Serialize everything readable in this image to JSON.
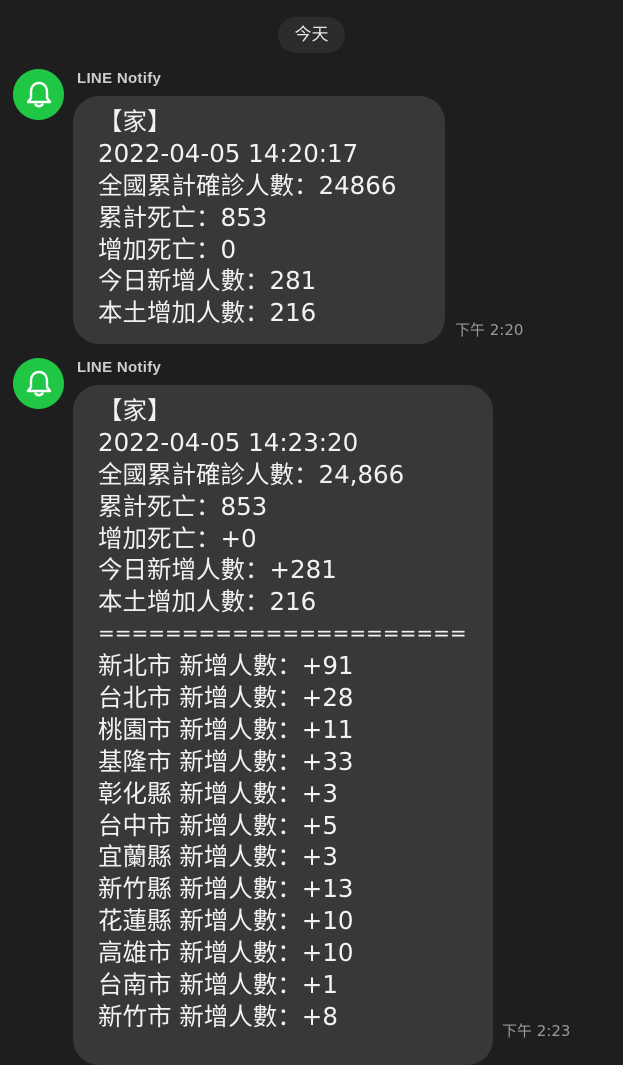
{
  "date_divider": "今天",
  "messages": [
    {
      "sender": "LINE Notify",
      "time": "下午 2:20",
      "lines": [
        "【家】",
        "2022-04-05 14:20:17",
        "全國累計確診人數：24866",
        "累計死亡：853",
        "增加死亡：0",
        "今日新增人數：281",
        "本土增加人數：216"
      ]
    },
    {
      "sender": "LINE Notify",
      "time": "下午 2:23",
      "lines": [
        "【家】",
        "2022-04-05 14:23:20",
        "全國累計確診人數：24,866",
        "累計死亡：853",
        "增加死亡：+0",
        "今日新增人數：+281",
        "本土增加人數：216",
        "======================",
        "新北市 新增人數：+91",
        "台北市 新增人數：+28",
        "桃園市 新增人數：+11",
        "基隆市 新增人數：+33",
        "彰化縣 新增人數：+3",
        "台中市 新增人數：+5",
        "宜蘭縣 新增人數：+3",
        "新竹縣 新增人數：+13",
        "花蓮縣 新增人數：+10",
        "高雄市 新增人數：+10",
        "台南市 新增人數：+1",
        "新竹市 新增人數：+8"
      ]
    }
  ],
  "colors": {
    "background": "#1e1e1e",
    "bubble": "#383838",
    "avatar": "#1fc745",
    "timestamp": "#9a9a9a"
  },
  "icons": {
    "avatar": "bell-icon"
  }
}
